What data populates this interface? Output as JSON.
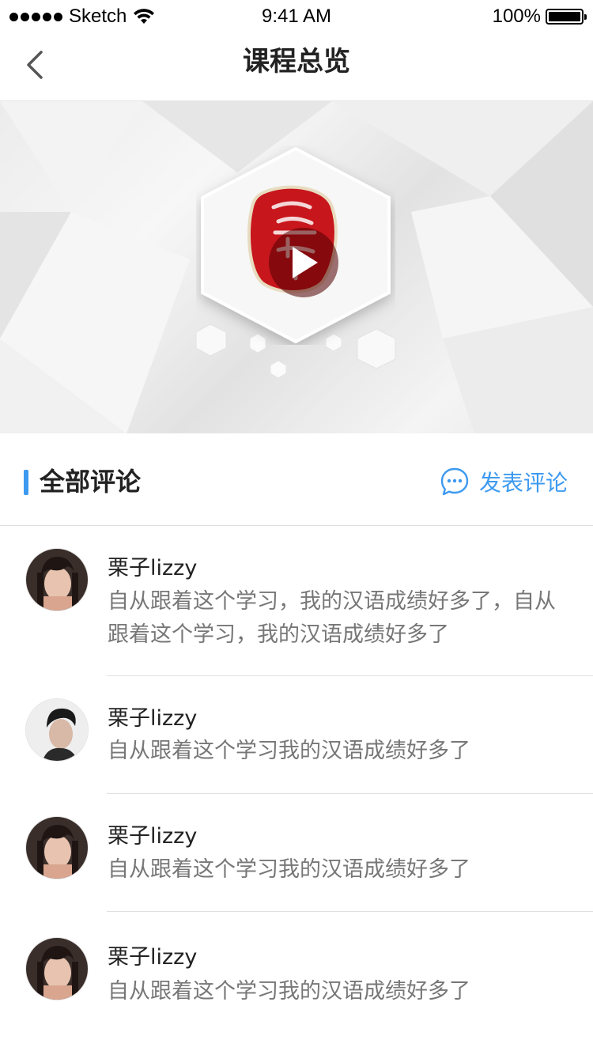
{
  "status_bar": {
    "carrier": "Sketch",
    "time": "9:41 AM",
    "battery": "100%",
    "battery_level": 1.0
  },
  "nav": {
    "title": "课程总览",
    "back_icon": "chevron-left-icon"
  },
  "banner": {
    "play_icon": "play-icon",
    "logo": "seal-logo"
  },
  "section": {
    "title": "全部评论",
    "post_label": "发表评论",
    "post_icon": "chat-bubble-icon",
    "accent_color": "#3d9af0"
  },
  "comments": [
    {
      "name": "栗子lizzy",
      "text": "自从跟着这个学习，我的汉语成绩好多了，自从跟着这个学习，我的汉语成绩好多了",
      "avatar": "female-avatar"
    },
    {
      "name": "栗子lizzy",
      "text": "自从跟着这个学习我的汉语成绩好多了",
      "avatar": "male-avatar"
    },
    {
      "name": "栗子lizzy",
      "text": "自从跟着这个学习我的汉语成绩好多了",
      "avatar": "female-avatar"
    },
    {
      "name": "栗子lizzy",
      "text": "自从跟着这个学习我的汉语成绩好多了",
      "avatar": "female-avatar"
    }
  ]
}
